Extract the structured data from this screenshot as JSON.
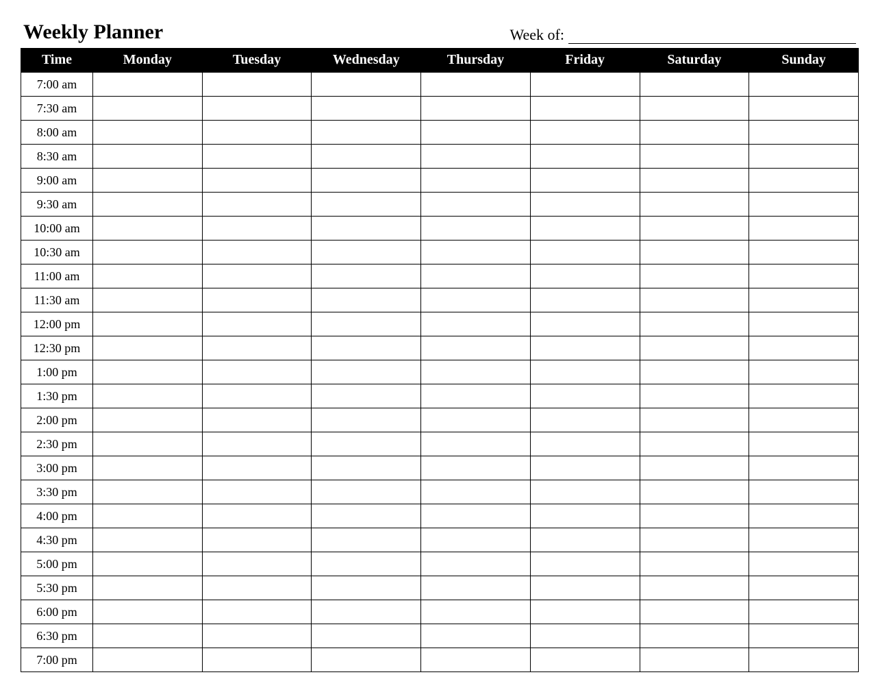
{
  "title": "Weekly Planner",
  "week_of_label": "Week of:",
  "week_of_value": "",
  "columns": {
    "time": "Time",
    "days": [
      "Monday",
      "Tuesday",
      "Wednesday",
      "Thursday",
      "Friday",
      "Saturday",
      "Sunday"
    ]
  },
  "times": [
    "7:00 am",
    "7:30 am",
    "8:00 am",
    "8:30 am",
    "9:00 am",
    "9:30 am",
    "10:00 am",
    "10:30 am",
    "11:00 am",
    "11:30 am",
    "12:00 pm",
    "12:30 pm",
    "1:00 pm",
    "1:30 pm",
    "2:00 pm",
    "2:30 pm",
    "3:00 pm",
    "3:30 pm",
    "4:00 pm",
    "4:30 pm",
    "5:00 pm",
    "5:30 pm",
    "6:00 pm",
    "6:30 pm",
    "7:00 pm"
  ]
}
